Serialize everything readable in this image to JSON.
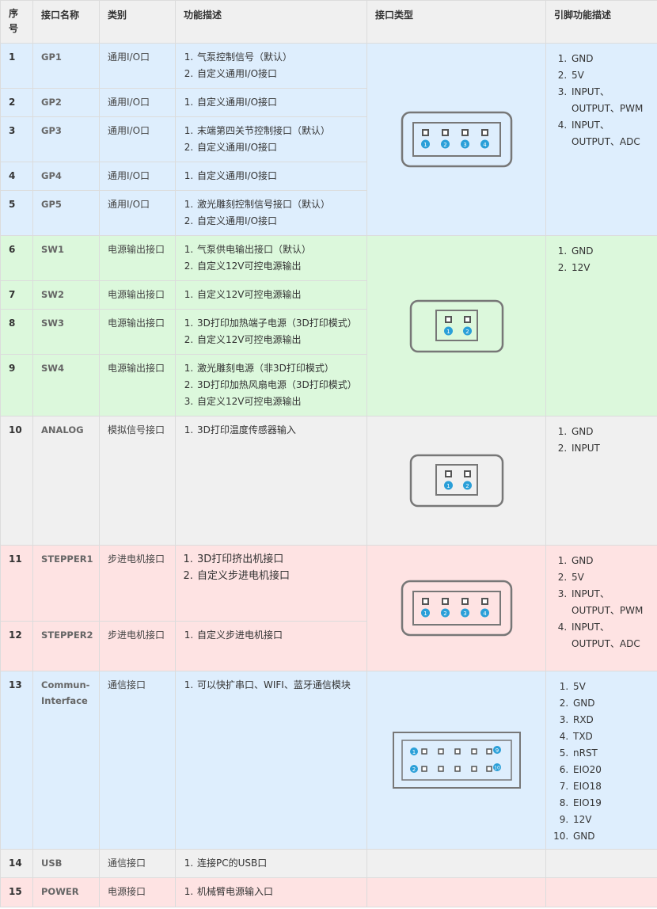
{
  "headers": {
    "seq": "序号",
    "name": "接口名称",
    "category": "类别",
    "function": "功能描述",
    "type": "接口类型",
    "pins": "引脚功能描述"
  },
  "rows": [
    {
      "num": "1",
      "name": "GP1",
      "category": "通用I/O口",
      "desc": [
        "气泵控制信号（默认）",
        "自定义通用I/O接口"
      ]
    },
    {
      "num": "2",
      "name": "GP2",
      "category": "通用I/O口",
      "desc": [
        "自定义通用I/O接口"
      ]
    },
    {
      "num": "3",
      "name": "GP3",
      "category": "通用I/O口",
      "desc": [
        "末端第四关节控制接口（默认）",
        "自定义通用I/O接口"
      ]
    },
    {
      "num": "4",
      "name": "GP4",
      "category": "通用I/O口",
      "desc": [
        "自定义通用I/O接口"
      ]
    },
    {
      "num": "5",
      "name": "GP5",
      "category": "通用I/O口",
      "desc": [
        "激光雕刻控制信号接口（默认）",
        "自定义通用I/O接口"
      ]
    },
    {
      "num": "6",
      "name": "SW1",
      "category": "电源输出接口",
      "desc": [
        "气泵供电输出接口（默认）",
        "自定义12V可控电源输出"
      ]
    },
    {
      "num": "7",
      "name": "SW2",
      "category": "电源输出接口",
      "desc": [
        "自定义12V可控电源输出"
      ]
    },
    {
      "num": "8",
      "name": "SW3",
      "category": "电源输出接口",
      "desc": [
        "3D打印加热端子电源（3D打印模式）",
        "自定义12V可控电源输出"
      ]
    },
    {
      "num": "9",
      "name": "SW4",
      "category": "电源输出接口",
      "desc": [
        "激光雕刻电源（非3D打印模式）",
        "3D打印加热风扇电源（3D打印模式）",
        "自定义12V可控电源输出"
      ]
    },
    {
      "num": "10",
      "name": "ANALOG",
      "category": "模拟信号接口",
      "desc": [
        "3D打印温度传感器输入"
      ]
    },
    {
      "num": "11",
      "name": "STEPPER1",
      "category": "步进电机接口",
      "desc": [
        "3D打印挤出机接口",
        "自定义步进电机接口"
      ]
    },
    {
      "num": "12",
      "name": "STEPPER2",
      "category": "步进电机接口",
      "desc": [
        "自定义步进电机接口"
      ]
    },
    {
      "num": "13",
      "name": "Commun-Interface",
      "category": "通信接口",
      "desc": [
        "可以快扩串口、WIFI、蓝牙通信模块"
      ]
    },
    {
      "num": "14",
      "name": "USB",
      "category": "通信接口",
      "desc": [
        "连接PC的USB口"
      ]
    },
    {
      "num": "15",
      "name": "POWER",
      "category": "电源接口",
      "desc": [
        "机械臂电源输入口"
      ]
    }
  ],
  "pins": {
    "gp": [
      "GND",
      "5V",
      "INPUT、OUTPUT、PWM",
      "INPUT、OUTPUT、ADC"
    ],
    "sw": [
      "GND",
      "12V"
    ],
    "analog": [
      "GND",
      "INPUT"
    ],
    "stepper": [
      "GND",
      "5V",
      "INPUT、OUTPUT、PWM",
      "INPUT、OUTPUT、ADC"
    ],
    "comm": [
      "5V",
      "GND",
      "RXD",
      "TXD",
      "nRST",
      "EIO20",
      "EIO18",
      "EIO19",
      "12V",
      "GND"
    ]
  },
  "connector_labels": {
    "four": [
      "1",
      "2",
      "3",
      "4"
    ],
    "two": [
      "1",
      "2"
    ],
    "comm_top": [
      "1",
      "9"
    ],
    "comm_bottom": [
      "2",
      "10"
    ]
  },
  "colors": {
    "blue": "#deeefd",
    "green": "#dcf8dc",
    "gray": "#f0f0f0",
    "pink": "#fee3e3",
    "pin_badge": "#2a9fd8",
    "connector_stroke": "#777777"
  }
}
